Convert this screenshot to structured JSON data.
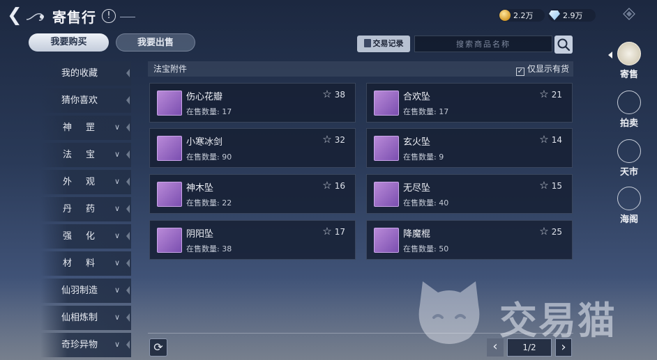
{
  "header": {
    "title": "寄售行",
    "info_symbol": "!",
    "currency_gold": "2.2万",
    "currency_jade": "2.9万"
  },
  "tabs": {
    "buy_label": "我要购买",
    "sell_label": "我要出售"
  },
  "toolbar": {
    "records_label": "交易记录",
    "search_placeholder": "搜索商品名称"
  },
  "sidebar": {
    "items": [
      {
        "label": "我的收藏",
        "expandable": false
      },
      {
        "label": "猜你喜欢",
        "expandable": false
      },
      {
        "label": "神罡",
        "expandable": true
      },
      {
        "label": "法宝",
        "expandable": true
      },
      {
        "label": "外观",
        "expandable": true
      },
      {
        "label": "丹药",
        "expandable": true
      },
      {
        "label": "强化",
        "expandable": true
      },
      {
        "label": "材料",
        "expandable": true
      },
      {
        "label": "仙羽制造",
        "expandable": true
      },
      {
        "label": "仙相炼制",
        "expandable": true
      },
      {
        "label": "奇珍异物",
        "expandable": true
      }
    ]
  },
  "category": {
    "title": "法宝附件",
    "stock_only_label": "仅显示有货",
    "stock_only_checked": true
  },
  "items": [
    {
      "name": "伤心花瓣",
      "qty_label": "在售数量:",
      "qty": "17",
      "favorites": "38"
    },
    {
      "name": "合欢坠",
      "qty_label": "在售数量:",
      "qty": "17",
      "favorites": "21"
    },
    {
      "name": "小寒冰剑",
      "qty_label": "在售数量:",
      "qty": "90",
      "favorites": "32"
    },
    {
      "name": "玄火坠",
      "qty_label": "在售数量:",
      "qty": "9",
      "favorites": "14"
    },
    {
      "name": "神木坠",
      "qty_label": "在售数量:",
      "qty": "22",
      "favorites": "16"
    },
    {
      "name": "无尽坠",
      "qty_label": "在售数量:",
      "qty": "40",
      "favorites": "15"
    },
    {
      "name": "阴阳坠",
      "qty_label": "在售数量:",
      "qty": "38",
      "favorites": "17"
    },
    {
      "name": "降魔棍",
      "qty_label": "在售数量:",
      "qty": "50",
      "favorites": "25"
    }
  ],
  "pager": {
    "page": "1/2",
    "prev": "‹",
    "next": "›",
    "refresh": "⟳"
  },
  "right_nav": [
    {
      "label": "寄售",
      "icon": "consignment-icon",
      "active": true
    },
    {
      "label": "拍卖",
      "icon": "auction-icon",
      "active": false
    },
    {
      "label": "天市",
      "icon": "sky-market-icon",
      "active": false
    },
    {
      "label": "海阁",
      "icon": "sea-pavilion-icon",
      "active": false
    }
  ],
  "watermark": {
    "text": "交易猫"
  },
  "colors": {
    "background_top": "#1c2840",
    "background_bottom": "#5c6e8e",
    "card_bg": "#16203499",
    "item_icon_purple": "#9a6cc6",
    "active_tab": "#eef2f8"
  }
}
